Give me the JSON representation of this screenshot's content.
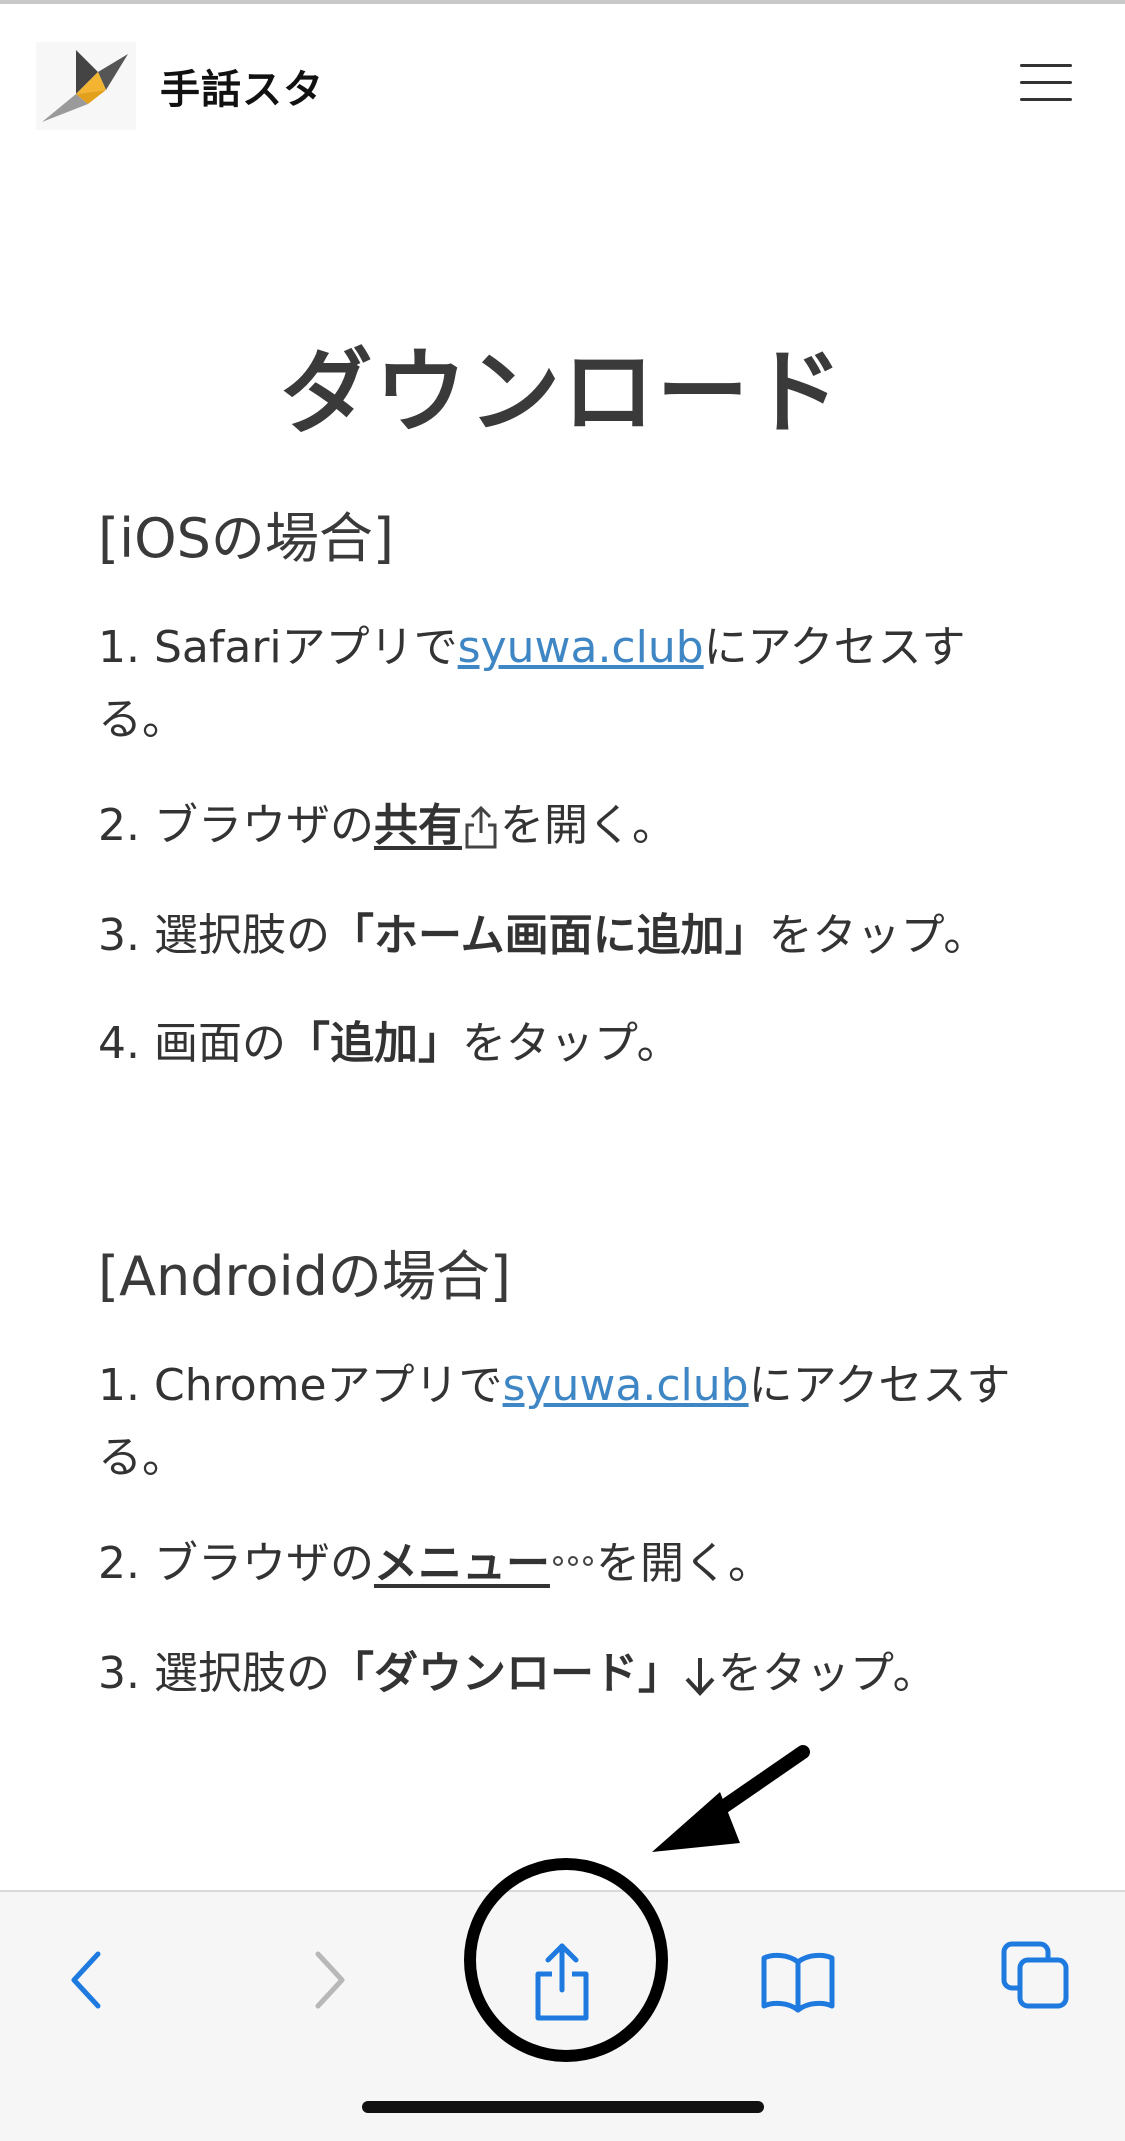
{
  "header": {
    "logo_text": "手話スタ",
    "menu_icon": "hamburger-menu-icon"
  },
  "page": {
    "title": "ダウンロード"
  },
  "ios": {
    "heading": "[iOSの場合]",
    "step1": {
      "prefix": "1. Safariアプリで",
      "link": "syuwa.club",
      "suffix": "にアクセスする。"
    },
    "step2": {
      "prefix": "2. ブラウザの",
      "emph": "共有",
      "suffix": "を開く。",
      "icon": "share-icon"
    },
    "step3": {
      "prefix": "3. 選択肢の",
      "emph": "「ホーム画面に追加」",
      "suffix": "をタップ。"
    },
    "step4": {
      "prefix": "4. 画面の",
      "emph": "「追加」",
      "suffix": "をタップ。"
    }
  },
  "android": {
    "heading": "[Androidの場合]",
    "step1": {
      "prefix": "1. Chromeアプリで",
      "link": "syuwa.club",
      "suffix": "にアクセスする。"
    },
    "step2": {
      "prefix": "2. ブラウザの",
      "emph": "メニュー",
      "suffix": "を開く。",
      "icon": "more-dots-icon"
    },
    "step3": {
      "prefix": "3. 選択肢の",
      "emph": "「ダウンロード」",
      "suffix": "をタップ。",
      "icon": "download-arrow-icon"
    }
  },
  "toolbar": {
    "buttons": [
      "back-icon",
      "forward-icon",
      "share-icon",
      "bookmarks-icon",
      "tabs-icon"
    ],
    "accent": "#1f7ae0",
    "disabled": "#b8b8b8"
  },
  "annotation": {
    "items": [
      "pointer-arrow",
      "highlight-circle"
    ]
  }
}
